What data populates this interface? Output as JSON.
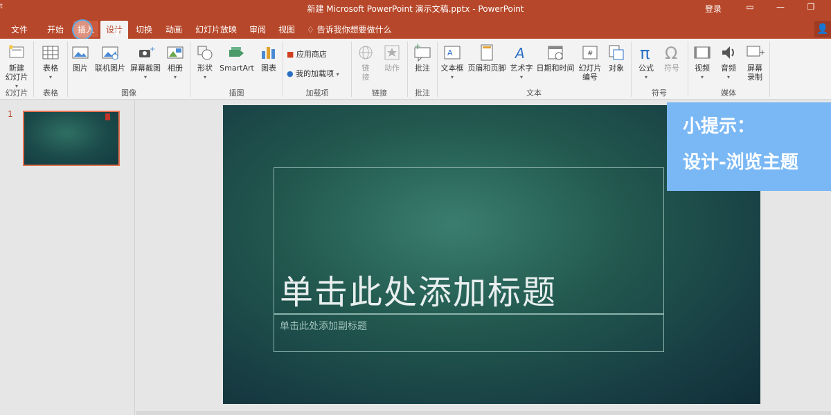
{
  "window": {
    "title": "新建 Microsoft PowerPoint 演示文稿.pptx - PowerPoint",
    "login": "登录",
    "edge_char": "t"
  },
  "tabs": {
    "file": "文件",
    "home": "开始",
    "insert": "插入",
    "design": "设计",
    "transitions": "切换",
    "animations": "动画",
    "slideshow": "幻灯片放映",
    "review": "审阅",
    "view": "视图",
    "tell_me": "告诉我你想要做什么"
  },
  "ribbon": {
    "new_slide": "新建\n幻灯片",
    "table": "表格",
    "pictures": "图片",
    "online_pictures": "联机图片",
    "screenshot": "屏幕截图",
    "album": "相册",
    "shapes": "形状",
    "smartart": "SmartArt",
    "chart": "图表",
    "store": "应用商店",
    "my_addins": "我的加载项",
    "link": "链\n接",
    "action": "动作",
    "comment": "批注",
    "textbox": "文本框",
    "header_footer": "页眉和页脚",
    "wordart": "艺术字",
    "datetime": "日期和时间",
    "slide_number": "幻灯片\n编号",
    "object": "对象",
    "equation": "公式",
    "symbol": "符号",
    "video": "视频",
    "audio": "音频",
    "screen_recording": "屏幕\n录制",
    "groups": {
      "slides": "幻灯片",
      "tables": "表格",
      "images": "图像",
      "illustrations": "插图",
      "addins": "加载项",
      "links": "链接",
      "comments": "批注",
      "text": "文本",
      "symbols": "符号",
      "media": "媒体"
    }
  },
  "thumbnails": [
    {
      "number": "1"
    }
  ],
  "slide": {
    "title_placeholder": "单击此处添加标题",
    "subtitle_placeholder": "单击此处添加副标题"
  },
  "tip": {
    "line1": "小提示：",
    "line2": "设计-浏览主题"
  },
  "colors": {
    "accent": "#b7472a",
    "ribbon_bg": "#f3f3f3",
    "tip_bg": "#7ab8f5",
    "slide_bg": "#22584f"
  }
}
